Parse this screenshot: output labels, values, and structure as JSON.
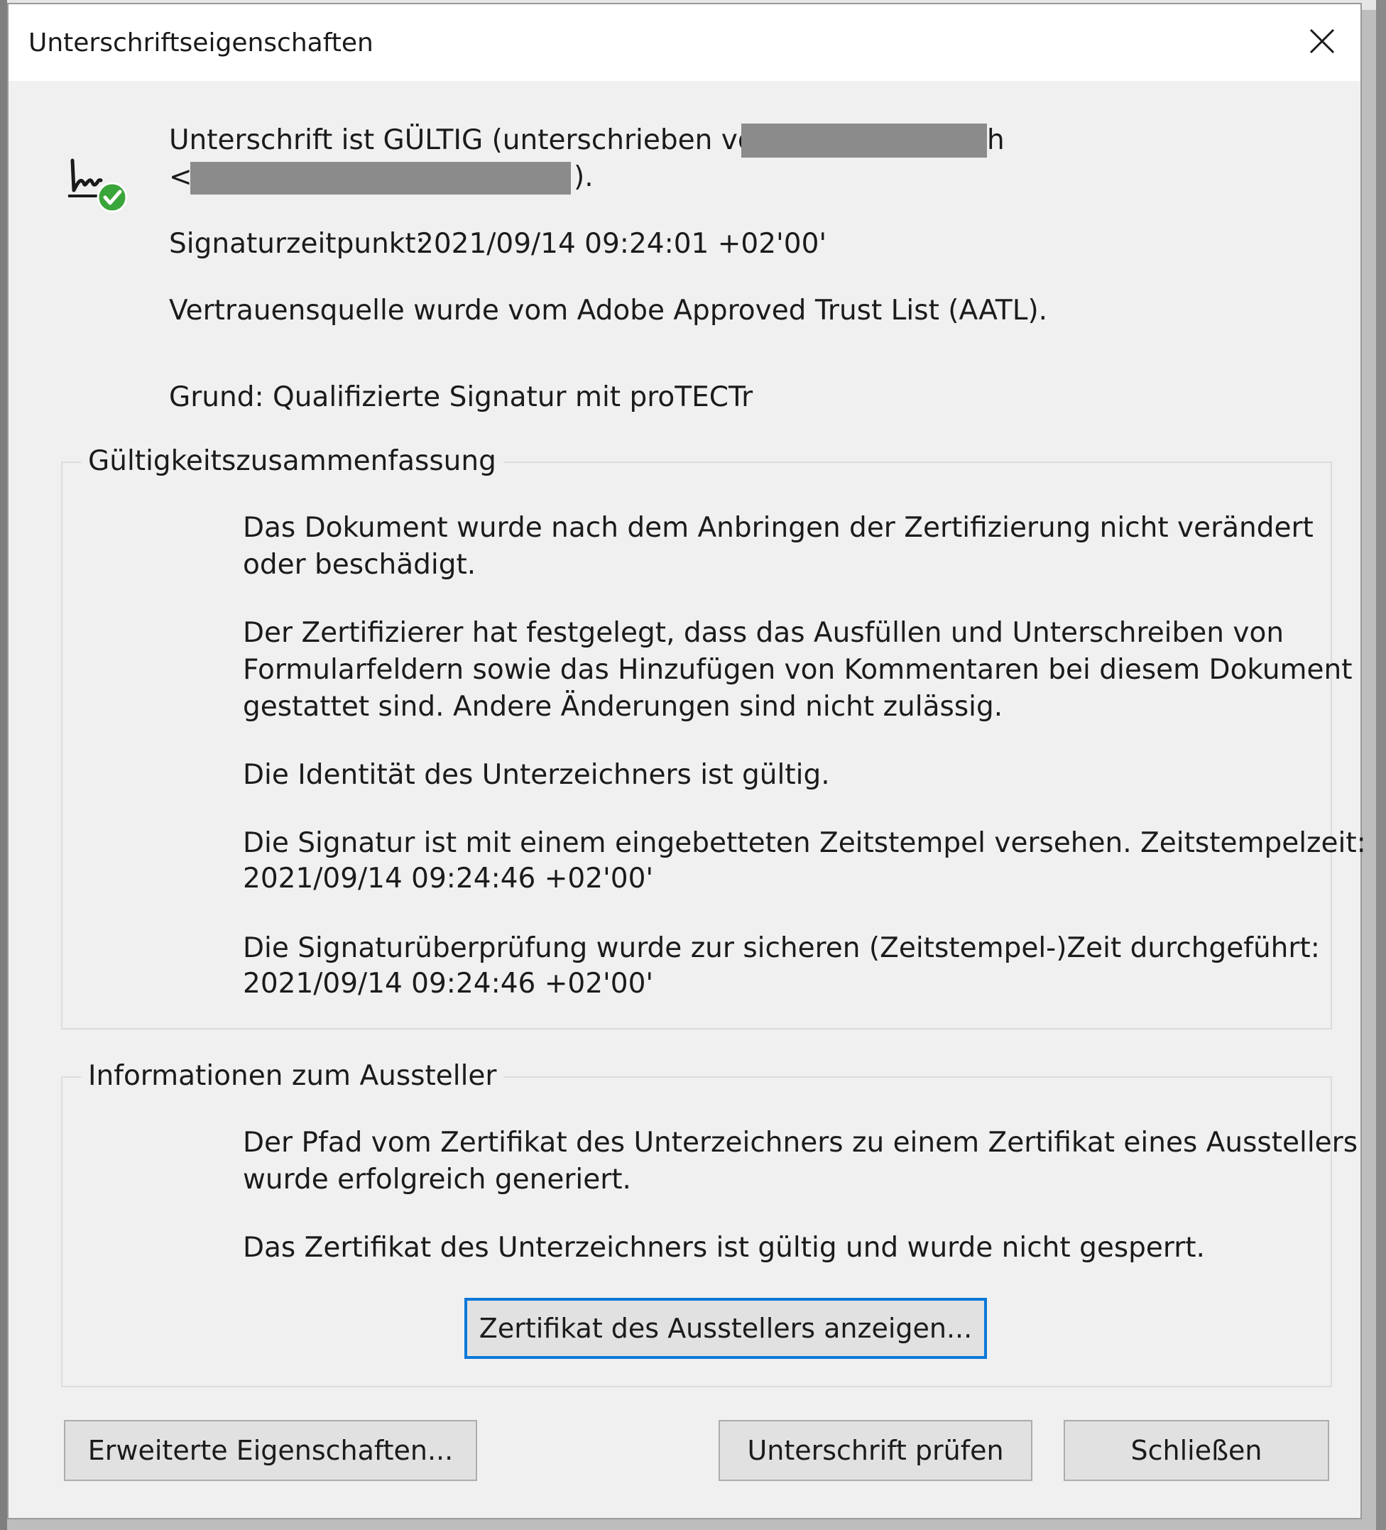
{
  "dialog": {
    "title": "Unterschriftseigenschaften"
  },
  "summary": {
    "status_prefix": "Unterschrift ist GÜLTIG (unterschrieben von T",
    "status_suffix": "h",
    "email_open": "<",
    "email_close": ").",
    "timestamp_label": "Signaturzeitpunkt:",
    "timestamp_value": "2021/09/14 09:24:01 +02'00'",
    "trust_source": "Vertrauensquelle wurde vom Adobe Approved Trust List (AATL).",
    "reason_label": "Grund:",
    "reason_value": "Qualifizierte Signatur mit proTECTr"
  },
  "validity_summary": {
    "heading": "Gültigkeitszusammenfassung",
    "p1_line1": "Das Dokument wurde nach dem Anbringen der Zertifizierung nicht verändert",
    "p1_line2": "oder beschädigt.",
    "p2_line1": "Der Zertifizierer hat festgelegt, dass das Ausfüllen und Unterschreiben von",
    "p2_line2": "Formularfeldern sowie das Hinzufügen von Kommentaren bei diesem Dokument",
    "p2_line3": "gestattet sind. Andere Änderungen sind nicht zulässig.",
    "p3_line1": "Die Identität des Unterzeichners ist gültig.",
    "p4_line1": "Die Signatur ist mit einem eingebetteten Zeitstempel versehen. Zeitstempelzeit:",
    "p4_line2": "2021/09/14 09:24:46 +02'00'",
    "p5_line1": "Die Signaturüberprüfung wurde zur sicheren (Zeitstempel-)Zeit durchgeführt:",
    "p5_line2": "2021/09/14 09:24:46 +02'00'"
  },
  "issuer_info": {
    "heading": "Informationen zum Aussteller",
    "p1_line1": "Der Pfad vom Zertifikat des Unterzeichners zu einem Zertifikat eines Ausstellers",
    "p1_line2": "wurde erfolgreich generiert.",
    "p2_line1": "Das Zertifikat des Unterzeichners ist gültig und wurde nicht gesperrt.",
    "show_cert_button": "Zertifikat des Ausstellers anzeigen..."
  },
  "footer": {
    "advanced_button": "Erweiterte Eigenschaften...",
    "verify_button": "Unterschrift prüfen",
    "close_button": "Schließen"
  },
  "icons": {
    "close": "close-icon",
    "signature": "signature-valid-icon"
  },
  "colors": {
    "focus_border": "#0b78d7",
    "valid_badge": "#3aa53a",
    "redaction": "#8b8b8b"
  }
}
